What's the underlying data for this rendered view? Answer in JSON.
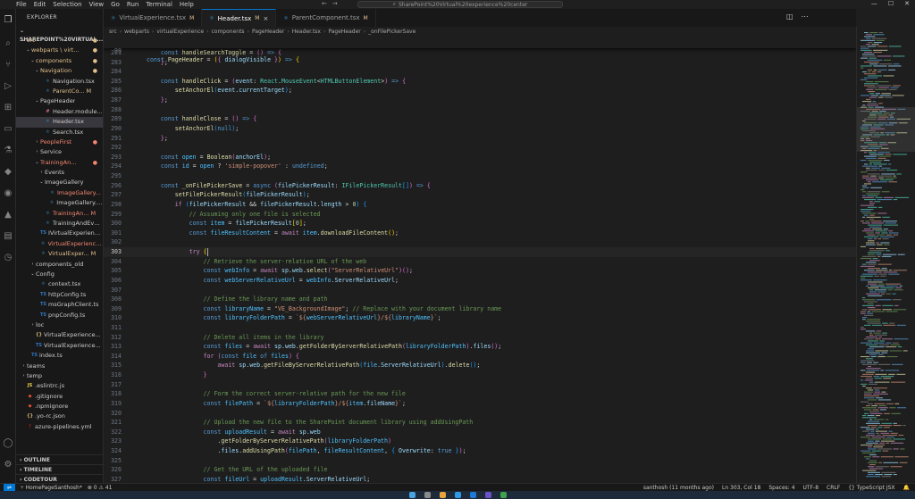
{
  "menu": [
    "File",
    "Edit",
    "Selection",
    "View",
    "Go",
    "Run",
    "Terminal",
    "Help"
  ],
  "search": {
    "value": "SharePoint%20Virtual%20experience%20center"
  },
  "sidebar": {
    "title": "EXPLORER",
    "root": "SHAREPOINT%20VIRTUAL...",
    "items": [
      {
        "indent": 1,
        "chev": "⌄",
        "label": "src",
        "type": "folder",
        "badge": "dot",
        "badge_class": "modified"
      },
      {
        "indent": 2,
        "chev": "⌄",
        "label": "webparts \\ virt...",
        "type": "folder",
        "badge": "dot",
        "badge_class": "modified"
      },
      {
        "indent": 3,
        "chev": "⌄",
        "label": "components",
        "type": "folder",
        "badge": "dot",
        "badge_class": "modified"
      },
      {
        "indent": 4,
        "chev": "⌄",
        "label": "Navigation",
        "type": "folder",
        "badge": "dot",
        "badge_class": "modified"
      },
      {
        "indent": 5,
        "chev": "",
        "label": "Navigation.tsx",
        "type": "tsx",
        "badge": "",
        "badge_class": ""
      },
      {
        "indent": 5,
        "chev": "",
        "label": "ParentCo... M",
        "type": "tsx",
        "badge": "",
        "badge_class": "modified"
      },
      {
        "indent": 4,
        "chev": "⌄",
        "label": "PageHeader",
        "type": "folder",
        "badge": "",
        "badge_class": ""
      },
      {
        "indent": 5,
        "chev": "",
        "label": "Header.module...",
        "type": "css",
        "badge": "",
        "badge_class": ""
      },
      {
        "indent": 5,
        "chev": "",
        "label": "Header.tsx",
        "type": "tsx",
        "badge": "",
        "badge_class": "",
        "selected": true
      },
      {
        "indent": 5,
        "chev": "",
        "label": "Search.tsx",
        "type": "tsx",
        "badge": "",
        "badge_class": ""
      },
      {
        "indent": 4,
        "chev": "›",
        "label": "PeopleFirst",
        "type": "folder",
        "badge": "dot",
        "badge_class": "error"
      },
      {
        "indent": 4,
        "chev": "›",
        "label": "Service",
        "type": "folder",
        "badge": "",
        "badge_class": ""
      },
      {
        "indent": 4,
        "chev": "⌄",
        "label": "TrainingAn...",
        "type": "folder",
        "badge": "dot",
        "badge_class": "error"
      },
      {
        "indent": 5,
        "chev": "›",
        "label": "Events",
        "type": "folder",
        "badge": "",
        "badge_class": ""
      },
      {
        "indent": 5,
        "chev": "⌄",
        "label": "ImageGallery",
        "type": "folder",
        "badge": "",
        "badge_class": ""
      },
      {
        "indent": 6,
        "chev": "",
        "label": "ImageGallery...",
        "type": "tsx",
        "badge": "",
        "badge_class": "error"
      },
      {
        "indent": 6,
        "chev": "",
        "label": "ImageGallery.tsx",
        "type": "tsx",
        "badge": "",
        "badge_class": ""
      },
      {
        "indent": 5,
        "chev": "",
        "label": "TrainingAn... M",
        "type": "tsx",
        "badge": "",
        "badge_class": "error"
      },
      {
        "indent": 5,
        "chev": "",
        "label": "TrainingAndEve...",
        "type": "tsx",
        "badge": "",
        "badge_class": ""
      },
      {
        "indent": 4,
        "chev": "",
        "label": "IVirtualExperienc...",
        "type": "ts",
        "badge": "",
        "badge_class": ""
      },
      {
        "indent": 4,
        "chev": "",
        "label": "VirtualExperience...",
        "type": "tsx",
        "badge": "",
        "badge_class": "error"
      },
      {
        "indent": 4,
        "chev": "",
        "label": "VirtualExper... M",
        "type": "tsx",
        "badge": "",
        "badge_class": "modified"
      },
      {
        "indent": 3,
        "chev": "›",
        "label": "components_old",
        "type": "folder",
        "badge": "",
        "badge_class": ""
      },
      {
        "indent": 3,
        "chev": "⌄",
        "label": "Config",
        "type": "folder",
        "badge": "",
        "badge_class": ""
      },
      {
        "indent": 4,
        "chev": "",
        "label": "context.tsx",
        "type": "tsx",
        "badge": "",
        "badge_class": ""
      },
      {
        "indent": 4,
        "chev": "",
        "label": "httpConfig.ts",
        "type": "ts",
        "badge": "",
        "badge_class": ""
      },
      {
        "indent": 4,
        "chev": "",
        "label": "msGraphClient.ts",
        "type": "ts",
        "badge": "",
        "badge_class": ""
      },
      {
        "indent": 4,
        "chev": "",
        "label": "pnpConfig.ts",
        "type": "ts",
        "badge": "",
        "badge_class": ""
      },
      {
        "indent": 3,
        "chev": "›",
        "label": "loc",
        "type": "folder",
        "badge": "",
        "badge_class": ""
      },
      {
        "indent": 3,
        "chev": "",
        "label": "VirtualExperience...",
        "type": "json",
        "badge": "",
        "badge_class": ""
      },
      {
        "indent": 3,
        "chev": "",
        "label": "VirtualExperience...",
        "type": "ts",
        "badge": "",
        "badge_class": ""
      },
      {
        "indent": 2,
        "chev": "",
        "label": "index.ts",
        "type": "ts",
        "badge": "",
        "badge_class": ""
      },
      {
        "indent": 1,
        "chev": "›",
        "label": "teams",
        "type": "folder",
        "badge": "",
        "badge_class": ""
      },
      {
        "indent": 1,
        "chev": "›",
        "label": "temp",
        "type": "folder",
        "badge": "",
        "badge_class": ""
      },
      {
        "indent": 1,
        "chev": "",
        "label": ".eslintrc.js",
        "type": "js",
        "badge": "",
        "badge_class": ""
      },
      {
        "indent": 1,
        "chev": "",
        "label": ".gitignore",
        "type": "git",
        "badge": "",
        "badge_class": ""
      },
      {
        "indent": 1,
        "chev": "",
        "label": ".npmignore",
        "type": "git",
        "badge": "",
        "badge_class": ""
      },
      {
        "indent": 1,
        "chev": "",
        "label": ".yo-rc.json",
        "type": "json",
        "badge": "",
        "badge_class": ""
      },
      {
        "indent": 1,
        "chev": "",
        "label": "azure-pipelines.yml",
        "type": "yml",
        "badge": "",
        "badge_class": ""
      }
    ],
    "bottom": [
      "OUTLINE",
      "TIMELINE",
      "CODETOUR"
    ]
  },
  "tabs": [
    {
      "label": "VirtualExperience.tsx",
      "mod": "M",
      "active": false
    },
    {
      "label": "Header.tsx",
      "mod": "M",
      "active": true
    },
    {
      "label": "ParentComponent.tsx",
      "mod": "M",
      "active": false
    }
  ],
  "breadcrumb": [
    "src",
    "webparts",
    "virtualExperience",
    "components",
    "PageHeader",
    "Header.tsx",
    "PageHeader",
    "_onFilePickerSave"
  ],
  "sticky": {
    "ln": "90",
    "html": "<span class='k'>const</span> <span class='f'>PageHeader</span> <span class='p'>=</span> <span class='br1'>(</span><span class='br2'>{</span> <span class='v'>dialogVisible</span> <span class='br2'>}</span><span class='br1'>)</span> <span class='k'>=></span> <span class='br1'>{</span>"
  },
  "code": [
    {
      "ln": "281",
      "html": "    <span class='k'>const</span> <span class='f'>handleSearchToggle</span> <span class='p'>=</span> <span class='br2'>()</span> <span class='k'>=></span> <span class='br2'>{</span>"
    },
    {
      "ln": "283",
      "html": "    <span class='br2'>}</span><span class='p'>;</span>"
    },
    {
      "ln": "284",
      "html": ""
    },
    {
      "ln": "285",
      "html": "    <span class='k'>const</span> <span class='f'>handleClick</span> <span class='p'>=</span> <span class='br2'>(</span><span class='v'>event</span><span class='p'>:</span> <span class='t'>React</span><span class='p'>.</span><span class='t'>MouseEvent</span><span class='p'>&lt;</span><span class='t'>HTMLButtonElement</span><span class='p'>&gt;</span><span class='br2'>)</span> <span class='k'>=></span> <span class='br2'>{</span>"
    },
    {
      "ln": "286",
      "html": "        <span class='f'>setAnchorEl</span><span class='br3'>(</span><span class='v'>event</span><span class='p'>.</span><span class='v'>currentTarget</span><span class='br3'>)</span><span class='p'>;</span>"
    },
    {
      "ln": "287",
      "html": "    <span class='br2'>}</span><span class='p'>;</span>"
    },
    {
      "ln": "288",
      "html": ""
    },
    {
      "ln": "289",
      "html": "    <span class='k'>const</span> <span class='f'>handleClose</span> <span class='p'>=</span> <span class='br2'>()</span> <span class='k'>=></span> <span class='br2'>{</span>"
    },
    {
      "ln": "290",
      "html": "        <span class='f'>setAnchorEl</span><span class='br3'>(</span><span class='k'>null</span><span class='br3'>)</span><span class='p'>;</span>"
    },
    {
      "ln": "291",
      "html": "    <span class='br2'>}</span><span class='p'>;</span>"
    },
    {
      "ln": "292",
      "html": ""
    },
    {
      "ln": "293",
      "html": "    <span class='k'>const</span> <span class='cst'>open</span> <span class='p'>=</span> <span class='f'>Boolean</span><span class='br2'>(</span><span class='v'>anchorEl</span><span class='br2'>)</span><span class='p'>;</span>"
    },
    {
      "ln": "294",
      "html": "    <span class='k'>const</span> <span class='cst'>id</span> <span class='p'>=</span> <span class='cst'>open</span> <span class='p'>?</span> <span class='s'>'simple-popover'</span> <span class='p'>:</span> <span class='k'>undefined</span><span class='p'>;</span>"
    },
    {
      "ln": "295",
      "html": ""
    },
    {
      "ln": "296",
      "html": "    <span class='k'>const</span> <span class='f'>_onFilePickerSave</span> <span class='p'>=</span> <span class='k'>async</span> <span class='br2'>(</span><span class='v'>filePickerResult</span><span class='p'>:</span> <span class='t'>IFilePickerResult</span><span class='br3'>[]</span><span class='br2'>)</span> <span class='k'>=></span> <span class='br2'>{</span>"
    },
    {
      "ln": "297",
      "html": "        <span class='f'>setFilePickerResult</span><span class='br3'>(</span><span class='v'>filePickerResult</span><span class='br3'>)</span><span class='p'>;</span>"
    },
    {
      "ln": "298",
      "html": "        <span class='kc'>if</span> <span class='br3'>(</span><span class='v'>filePickerResult</span> <span class='p'>&amp;&amp;</span> <span class='v'>filePickerResult</span><span class='p'>.</span><span class='v'>length</span> <span class='p'>&gt;</span> <span class='n'>0</span><span class='br3'>)</span> <span class='br3'>{</span>"
    },
    {
      "ln": "299",
      "html": "            <span class='cm'>// Assuming only one file is selected</span>"
    },
    {
      "ln": "300",
      "html": "            <span class='k'>const</span> <span class='cst'>item</span> <span class='p'>=</span> <span class='v'>filePickerResult</span><span class='br1'>[</span><span class='n'>0</span><span class='br1'>]</span><span class='p'>;</span>"
    },
    {
      "ln": "301",
      "html": "            <span class='k'>const</span> <span class='cst'>fileResultContent</span> <span class='p'>=</span> <span class='kc'>await</span> <span class='cst'>item</span><span class='p'>.</span><span class='f'>downloadFileContent</span><span class='br1'>()</span><span class='p'>;</span>"
    },
    {
      "ln": "302",
      "html": ""
    },
    {
      "ln": "303",
      "html": "            <span class='kc'>try</span> <span class='br1'>{</span><span class='cursor'></span>",
      "current": true
    },
    {
      "ln": "304",
      "html": "                <span class='cm'>// Retrieve the server-relative URL of the web</span>"
    },
    {
      "ln": "305",
      "html": "                <span class='k'>const</span> <span class='cst'>webInfo</span> <span class='p'>=</span> <span class='kc'>await</span> <span class='v'>sp</span><span class='p'>.</span><span class='v'>web</span><span class='p'>.</span><span class='f'>select</span><span class='br2'>(</span><span class='s'>\"ServerRelativeUrl\"</span><span class='br2'>)</span><span class='br2'>()</span><span class='p'>;</span>"
    },
    {
      "ln": "306",
      "html": "                <span class='k'>const</span> <span class='cst'>webServerRelativeUrl</span> <span class='p'>=</span> <span class='cst'>webInfo</span><span class='p'>.</span><span class='v'>ServerRelativeUrl</span><span class='p'>;</span>"
    },
    {
      "ln": "307",
      "html": ""
    },
    {
      "ln": "308",
      "html": "                <span class='cm'>// Define the library name and path</span>"
    },
    {
      "ln": "309",
      "html": "                <span class='k'>const</span> <span class='cst'>libraryName</span> <span class='p'>=</span> <span class='s'>\"VE_BackgroundImage\"</span><span class='p'>;</span> <span class='cm'>// Replace with your document library name</span>"
    },
    {
      "ln": "310",
      "html": "                <span class='k'>const</span> <span class='cst'>libraryFolderPath</span> <span class='p'>=</span> <span class='s'>`${</span><span class='cst'>webServerRelativeUrl</span><span class='s'>}/${</span><span class='cst'>libraryName</span><span class='s'>}`</span><span class='p'>;</span>"
    },
    {
      "ln": "311",
      "html": ""
    },
    {
      "ln": "312",
      "html": "                <span class='cm'>// Delete all items in the library</span>"
    },
    {
      "ln": "313",
      "html": "                <span class='k'>const</span> <span class='cst'>files</span> <span class='p'>=</span> <span class='kc'>await</span> <span class='v'>sp</span><span class='p'>.</span><span class='v'>web</span><span class='p'>.</span><span class='f'>getFolderByServerRelativePath</span><span class='br2'>(</span><span class='cst'>libraryFolderPath</span><span class='br2'>)</span><span class='p'>.</span><span class='v'>files</span><span class='br2'>()</span><span class='p'>;</span>"
    },
    {
      "ln": "314",
      "html": "                <span class='kc'>for</span> <span class='br2'>(</span><span class='k'>const</span> <span class='cst'>file</span> <span class='k'>of</span> <span class='cst'>files</span><span class='br2'>)</span> <span class='br2'>{</span>"
    },
    {
      "ln": "315",
      "html": "                    <span class='kc'>await</span> <span class='v'>sp</span><span class='p'>.</span><span class='v'>web</span><span class='p'>.</span><span class='f'>getFileByServerRelativePath</span><span class='br3'>(</span><span class='cst'>file</span><span class='p'>.</span><span class='v'>ServerRelativeUrl</span><span class='br3'>)</span><span class='p'>.</span><span class='f'>delete</span><span class='br3'>()</span><span class='p'>;</span>"
    },
    {
      "ln": "316",
      "html": "                <span class='br2'>}</span>"
    },
    {
      "ln": "317",
      "html": ""
    },
    {
      "ln": "318",
      "html": "                <span class='cm'>// Form the correct server-relative path for the new file</span>"
    },
    {
      "ln": "319",
      "html": "                <span class='k'>const</span> <span class='cst'>filePath</span> <span class='p'>=</span> <span class='s'>`${</span><span class='cst'>libraryFolderPath</span><span class='s'>}/${</span><span class='cst'>item</span><span class='p'>.</span><span class='v'>fileName</span><span class='s'>}`</span><span class='p'>;</span>"
    },
    {
      "ln": "320",
      "html": ""
    },
    {
      "ln": "321",
      "html": "                <span class='cm'>// Upload the new file to the SharePoint document library using addUsingPath</span>"
    },
    {
      "ln": "322",
      "html": "                <span class='k'>const</span> <span class='cst'>uploadResult</span> <span class='p'>=</span> <span class='kc'>await</span> <span class='v'>sp</span><span class='p'>.</span><span class='v'>web</span>"
    },
    {
      "ln": "323",
      "html": "                    <span class='p'>.</span><span class='f'>getFolderByServerRelativePath</span><span class='br2'>(</span><span class='cst'>libraryFolderPath</span><span class='br2'>)</span>"
    },
    {
      "ln": "324",
      "html": "                    <span class='p'>.</span><span class='v'>files</span><span class='p'>.</span><span class='f'>addUsingPath</span><span class='br2'>(</span><span class='cst'>filePath</span><span class='p'>,</span> <span class='cst'>fileResultContent</span><span class='p'>,</span> <span class='br3'>{</span> <span class='v'>Overwrite</span><span class='p'>:</span> <span class='k'>true</span> <span class='br3'>}</span><span class='br2'>)</span><span class='p'>;</span>"
    },
    {
      "ln": "325",
      "html": ""
    },
    {
      "ln": "326",
      "html": "                <span class='cm'>// Get the URL of the uploaded file</span>"
    },
    {
      "ln": "327",
      "html": "                <span class='k'>const</span> <span class='cst'>fileUrl</span> <span class='p'>=</span> <span class='cst'>uploadResult</span><span class='p'>.</span><span class='v'>ServerRelativeUrl</span><span class='p'>;</span>"
    },
    {
      "ln": "328",
      "html": ""
    },
    {
      "ln": "329",
      "html": "                <span class='cm'>// Update the background image state</span>"
    }
  ],
  "status": {
    "branch": "HomePageSanthosh*",
    "problems": "⊗ 0  ⚠ 41",
    "blame": "santhosh (11 months ago)",
    "position": "Ln 303, Col 18",
    "spaces": "Spaces: 4",
    "encoding": "UTF-8",
    "eol": "CRLF",
    "language": "TypeScript JSX"
  },
  "colors": {
    "accent": "#0078d4",
    "modified": "#e2c08d",
    "error": "#f48771"
  }
}
